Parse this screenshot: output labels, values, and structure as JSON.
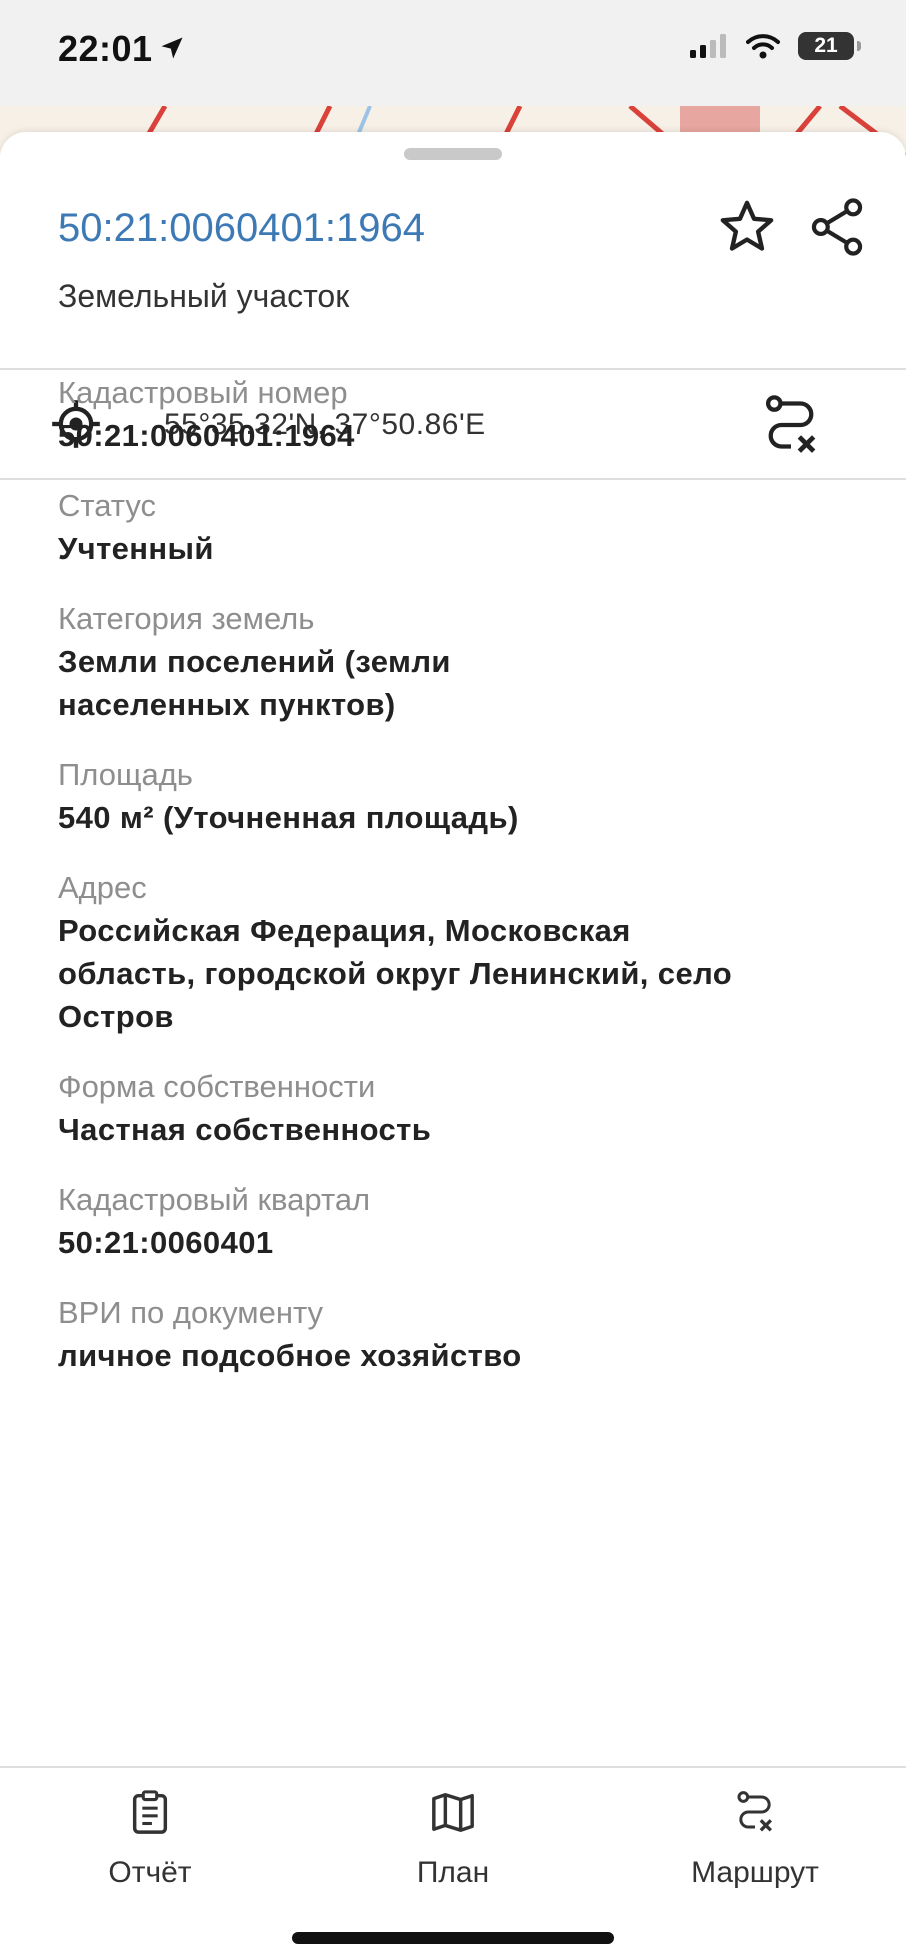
{
  "status_bar": {
    "time": "22:01",
    "battery_level": "21"
  },
  "header": {
    "title": "50:21:0060401:1964",
    "subtitle": "Земельный участок",
    "favorite_icon": "star-icon",
    "share_icon": "share-icon"
  },
  "coordinates": {
    "text": "55°35.32'N, 37°50.86'E",
    "locate_icon": "target-icon",
    "route_icon": "route-remove-icon"
  },
  "properties": [
    {
      "label": "Кадастровый номер",
      "value": "50:21:0060401:1964"
    },
    {
      "label": "Статус",
      "value": "Учтенный"
    },
    {
      "label": "Категория земель",
      "value": "Земли поселений (земли\nнаселенных пунктов)"
    },
    {
      "label": "Площадь",
      "value": "540 м² (Уточненная площадь)"
    },
    {
      "label": "Адрес",
      "value": "Российская Федерация, Московская\nобласть, городской округ Ленинский, село\nОстров"
    },
    {
      "label": "Форма собственности",
      "value": "Частная собственность"
    },
    {
      "label": "Кадастровый квартал",
      "value": "50:21:0060401"
    },
    {
      "label": "ВРИ по документу",
      "value": "личное подсобное хозяйство"
    }
  ],
  "tabs": [
    {
      "label": "Отчёт",
      "icon": "clipboard-icon"
    },
    {
      "label": "План",
      "icon": "map-icon"
    },
    {
      "label": "Маршрут",
      "icon": "route-icon"
    }
  ],
  "colors": {
    "accent": "#3d7ab5",
    "label": "#8e8e8e",
    "map_line_red": "#d9413a"
  }
}
